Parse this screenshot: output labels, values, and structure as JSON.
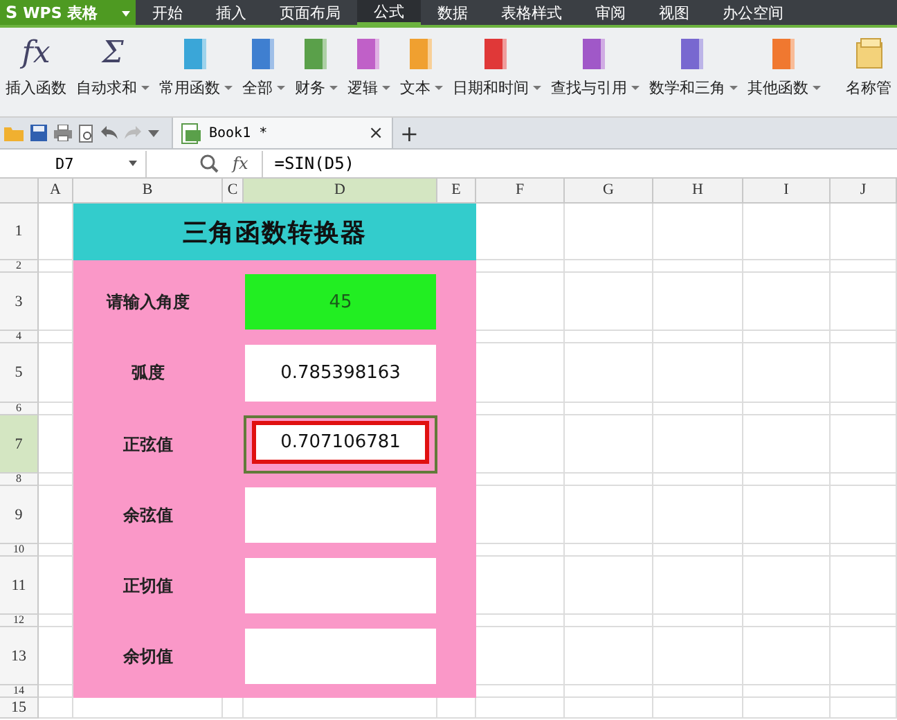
{
  "app": {
    "logo": "S",
    "name": "WPS 表格"
  },
  "menu_tabs": [
    {
      "label": "开始",
      "selected": false
    },
    {
      "label": "插入",
      "selected": false
    },
    {
      "label": "页面布局",
      "selected": false
    },
    {
      "label": "公式",
      "selected": true
    },
    {
      "label": "数据",
      "selected": false
    },
    {
      "label": "表格样式",
      "selected": false
    },
    {
      "label": "审阅",
      "selected": false
    },
    {
      "label": "视图",
      "selected": false
    },
    {
      "label": "办公空间",
      "selected": false
    }
  ],
  "ribbon_buttons": [
    {
      "kind": "glyph",
      "glyph": "fx",
      "label": "插入函数",
      "dropdown": false
    },
    {
      "kind": "glyph",
      "glyph": "Σ",
      "label": "自动求和",
      "dropdown": true
    },
    {
      "kind": "book",
      "color": "#3aa6d8",
      "label": "常用函数",
      "dropdown": true
    },
    {
      "kind": "book",
      "color": "#3f7fd0",
      "label": "全部",
      "dropdown": true
    },
    {
      "kind": "book",
      "color": "#5aa04a",
      "label": "财务",
      "dropdown": true
    },
    {
      "kind": "book",
      "color": "#c060c8",
      "label": "逻辑",
      "dropdown": true
    },
    {
      "kind": "book",
      "color": "#f0a030",
      "label": "文本",
      "dropdown": true
    },
    {
      "kind": "book",
      "color": "#e03838",
      "label": "日期和时间",
      "dropdown": true
    },
    {
      "kind": "book",
      "color": "#a058c8",
      "label": "查找与引用",
      "dropdown": true
    },
    {
      "kind": "book",
      "color": "#7868d0",
      "label": "数学和三角",
      "dropdown": true
    },
    {
      "kind": "book",
      "color": "#f07830",
      "label": "其他函数",
      "dropdown": true
    },
    {
      "kind": "folder",
      "label": "名称管",
      "dropdown": false
    }
  ],
  "document_tabs": [
    {
      "label": "Book1 *",
      "selected": true,
      "close": "×"
    }
  ],
  "new_tab": "+",
  "formula_bar": {
    "cell_ref": "D7",
    "fx": "fx",
    "formula": "=SIN(D5)"
  },
  "sheet": {
    "columns": [
      {
        "label": "A",
        "selected": false
      },
      {
        "label": "B",
        "selected": false
      },
      {
        "label": "C",
        "selected": false
      },
      {
        "label": "D",
        "selected": true
      },
      {
        "label": "E",
        "selected": false
      },
      {
        "label": "F",
        "selected": false
      },
      {
        "label": "G",
        "selected": false
      },
      {
        "label": "H",
        "selected": false
      },
      {
        "label": "I",
        "selected": false
      },
      {
        "label": "J",
        "selected": false
      }
    ],
    "rows": [
      {
        "label": "1",
        "selected": false
      },
      {
        "label": "2",
        "selected": false
      },
      {
        "label": "3",
        "selected": false
      },
      {
        "label": "4",
        "selected": false
      },
      {
        "label": "5",
        "selected": false
      },
      {
        "label": "6",
        "selected": false
      },
      {
        "label": "7",
        "selected": true
      },
      {
        "label": "8",
        "selected": false
      },
      {
        "label": "9",
        "selected": false
      },
      {
        "label": "10",
        "selected": false
      },
      {
        "label": "11",
        "selected": false
      },
      {
        "label": "12",
        "selected": false
      },
      {
        "label": "13",
        "selected": false
      },
      {
        "label": "14",
        "selected": false
      },
      {
        "label": "15",
        "selected": false
      }
    ],
    "title": "三角函数转换器",
    "fields": [
      {
        "label": "请输入角度",
        "value": "45",
        "kind": "input",
        "active": false,
        "highlighted": false
      },
      {
        "label": "弧度",
        "value": "0.785398163",
        "kind": "output",
        "active": false,
        "highlighted": false
      },
      {
        "label": "正弦值",
        "value": "0.707106781",
        "kind": "output",
        "active": true,
        "highlighted": true
      },
      {
        "label": "余弦值",
        "kind": "output",
        "active": false,
        "highlighted": false
      },
      {
        "label": "正切值",
        "kind": "output",
        "active": false,
        "highlighted": false
      },
      {
        "label": "余切值",
        "kind": "output",
        "active": false,
        "highlighted": false
      }
    ]
  }
}
